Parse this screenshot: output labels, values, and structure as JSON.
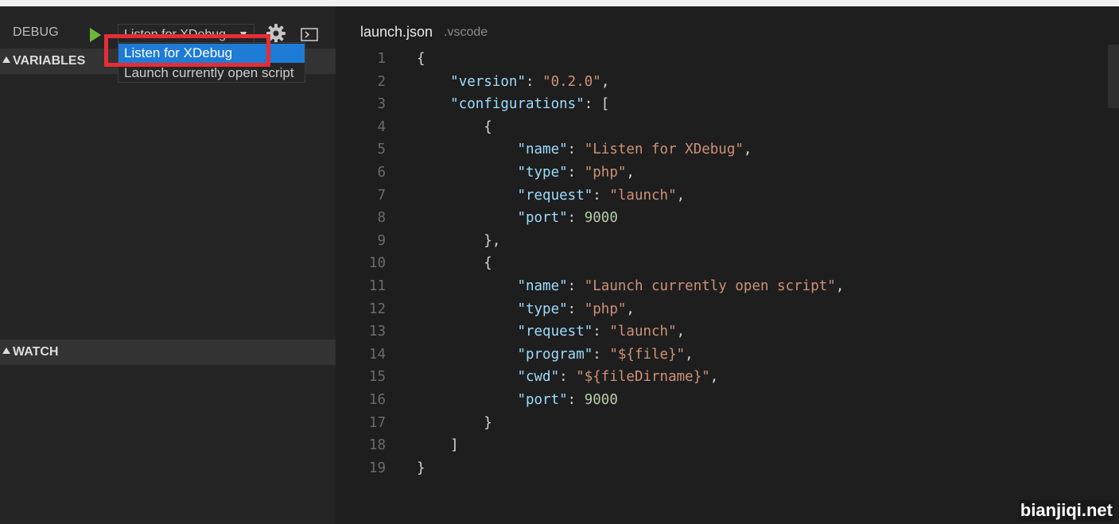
{
  "colors": {
    "play": "#6cb83a",
    "selection": "#1e7bd6",
    "annotation_box": "#e62d35",
    "json_key": "#9cdcfe",
    "json_string": "#ce9178",
    "json_number": "#b5cea8"
  },
  "debug_panel": {
    "title": "DEBUG",
    "start_icon": "play-icon",
    "config_select": {
      "selected": "Listen for XDebug",
      "arrow": "▼"
    },
    "settings_icon": "gear-icon",
    "console_icon": "debug-console-icon",
    "dropdown_options": [
      "Listen for XDebug",
      "Launch currently open script"
    ],
    "sections": {
      "variables": "VARIABLES",
      "watch": "WATCH"
    }
  },
  "editor": {
    "filename": "launch.json",
    "path": ".vscode",
    "lines": [
      {
        "num": "1",
        "tokens": [
          {
            "t": "{",
            "c": "p"
          }
        ]
      },
      {
        "num": "2",
        "tokens": [
          {
            "t": "    ",
            "c": "p"
          },
          {
            "t": "\"version\"",
            "c": "k"
          },
          {
            "t": ": ",
            "c": "p"
          },
          {
            "t": "\"0.2.0\"",
            "c": "s"
          },
          {
            "t": ",",
            "c": "p"
          }
        ]
      },
      {
        "num": "3",
        "tokens": [
          {
            "t": "    ",
            "c": "p"
          },
          {
            "t": "\"configurations\"",
            "c": "k"
          },
          {
            "t": ": [",
            "c": "p"
          }
        ]
      },
      {
        "num": "4",
        "tokens": [
          {
            "t": "        {",
            "c": "p"
          }
        ]
      },
      {
        "num": "5",
        "tokens": [
          {
            "t": "            ",
            "c": "p"
          },
          {
            "t": "\"name\"",
            "c": "k"
          },
          {
            "t": ": ",
            "c": "p"
          },
          {
            "t": "\"Listen for XDebug\"",
            "c": "s"
          },
          {
            "t": ",",
            "c": "p"
          }
        ]
      },
      {
        "num": "6",
        "tokens": [
          {
            "t": "            ",
            "c": "p"
          },
          {
            "t": "\"type\"",
            "c": "k"
          },
          {
            "t": ": ",
            "c": "p"
          },
          {
            "t": "\"php\"",
            "c": "s"
          },
          {
            "t": ",",
            "c": "p"
          }
        ]
      },
      {
        "num": "7",
        "tokens": [
          {
            "t": "            ",
            "c": "p"
          },
          {
            "t": "\"request\"",
            "c": "k"
          },
          {
            "t": ": ",
            "c": "p"
          },
          {
            "t": "\"launch\"",
            "c": "s"
          },
          {
            "t": ",",
            "c": "p"
          }
        ]
      },
      {
        "num": "8",
        "tokens": [
          {
            "t": "            ",
            "c": "p"
          },
          {
            "t": "\"port\"",
            "c": "k"
          },
          {
            "t": ": ",
            "c": "p"
          },
          {
            "t": "9000",
            "c": "n"
          }
        ]
      },
      {
        "num": "9",
        "tokens": [
          {
            "t": "        },",
            "c": "p"
          }
        ]
      },
      {
        "num": "10",
        "tokens": [
          {
            "t": "        {",
            "c": "p"
          }
        ]
      },
      {
        "num": "11",
        "tokens": [
          {
            "t": "            ",
            "c": "p"
          },
          {
            "t": "\"name\"",
            "c": "k"
          },
          {
            "t": ": ",
            "c": "p"
          },
          {
            "t": "\"Launch currently open script\"",
            "c": "s"
          },
          {
            "t": ",",
            "c": "p"
          }
        ]
      },
      {
        "num": "12",
        "tokens": [
          {
            "t": "            ",
            "c": "p"
          },
          {
            "t": "\"type\"",
            "c": "k"
          },
          {
            "t": ": ",
            "c": "p"
          },
          {
            "t": "\"php\"",
            "c": "s"
          },
          {
            "t": ",",
            "c": "p"
          }
        ]
      },
      {
        "num": "13",
        "tokens": [
          {
            "t": "            ",
            "c": "p"
          },
          {
            "t": "\"request\"",
            "c": "k"
          },
          {
            "t": ": ",
            "c": "p"
          },
          {
            "t": "\"launch\"",
            "c": "s"
          },
          {
            "t": ",",
            "c": "p"
          }
        ]
      },
      {
        "num": "14",
        "tokens": [
          {
            "t": "            ",
            "c": "p"
          },
          {
            "t": "\"program\"",
            "c": "k"
          },
          {
            "t": ": ",
            "c": "p"
          },
          {
            "t": "\"${file}\"",
            "c": "s"
          },
          {
            "t": ",",
            "c": "p"
          }
        ]
      },
      {
        "num": "15",
        "tokens": [
          {
            "t": "            ",
            "c": "p"
          },
          {
            "t": "\"cwd\"",
            "c": "k"
          },
          {
            "t": ": ",
            "c": "p"
          },
          {
            "t": "\"${fileDirname}\"",
            "c": "s"
          },
          {
            "t": ",",
            "c": "p"
          }
        ]
      },
      {
        "num": "16",
        "tokens": [
          {
            "t": "            ",
            "c": "p"
          },
          {
            "t": "\"port\"",
            "c": "k"
          },
          {
            "t": ": ",
            "c": "p"
          },
          {
            "t": "9000",
            "c": "n"
          }
        ]
      },
      {
        "num": "17",
        "tokens": [
          {
            "t": "        }",
            "c": "p"
          }
        ]
      },
      {
        "num": "18",
        "tokens": [
          {
            "t": "    ]",
            "c": "p"
          }
        ]
      },
      {
        "num": "19",
        "tokens": [
          {
            "t": "}",
            "c": "p"
          }
        ]
      }
    ]
  },
  "watermark": "bianjiqi.net"
}
